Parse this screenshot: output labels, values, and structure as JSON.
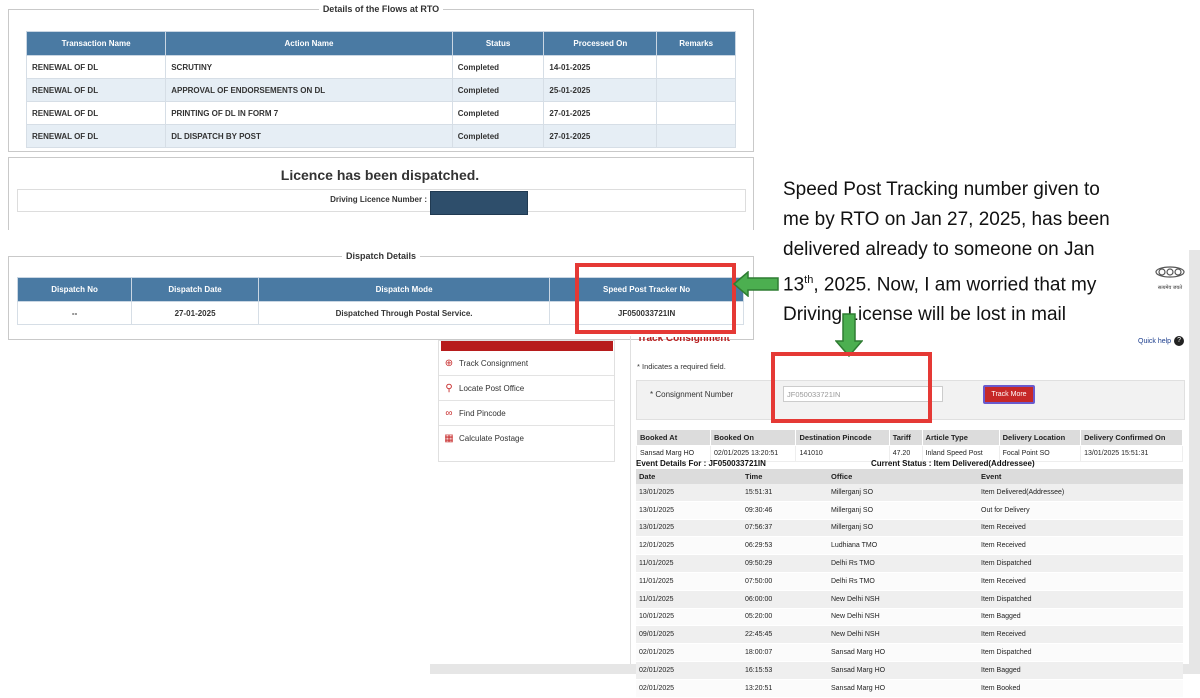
{
  "rto": {
    "legend": "Details of the Flows at RTO",
    "headers": [
      "Transaction Name",
      "Action Name",
      "Status",
      "Processed On",
      "Remarks"
    ],
    "rows": [
      [
        "RENEWAL OF DL",
        "SCRUTINY",
        "Completed",
        "14-01-2025",
        ""
      ],
      [
        "RENEWAL OF DL",
        "APPROVAL OF ENDORSEMENTS ON DL",
        "Completed",
        "25-01-2025",
        ""
      ],
      [
        "RENEWAL OF DL",
        "PRINTING OF DL IN FORM 7",
        "Completed",
        "27-01-2025",
        ""
      ],
      [
        "RENEWAL OF DL",
        "DL DISPATCH BY POST",
        "Completed",
        "27-01-2025",
        ""
      ]
    ]
  },
  "licence": {
    "message": "Licence has been dispatched.",
    "dl_label": "Driving Licence Number :"
  },
  "dispatch": {
    "legend": "Dispatch Details",
    "headers": [
      "Dispatch No",
      "Dispatch Date",
      "Dispatch Mode",
      "Speed Post Tracker No"
    ],
    "row": [
      "--",
      "27-01-2025",
      "Dispatched Through Postal Service.",
      "JF050033721IN"
    ]
  },
  "annotation": {
    "line1": "Speed Post Tracking number given to",
    "line2": "me by RTO on Jan 27, 2025, has been",
    "line3": "delivered already to someone on Jan",
    "line4_a": "13",
    "line4_sup": "th",
    "line4_b": ", 2025. Now, I am worried that my",
    "line5": "Driving License will be lost in mail",
    "arrow_color": "#4caf50",
    "box_color": "#e53935"
  },
  "post": {
    "emblem_text": "सत्यमेव जयते",
    "quick_help": "Quick help",
    "section_title": "Track Consignment",
    "side_menu": [
      "Track Consignment",
      "Locate Post Office",
      "Find Pincode",
      "Calculate Postage"
    ],
    "required_note": "* Indicates a required field.",
    "consignment_label": "* Consignment Number",
    "consignment_value": "JF050033721IN",
    "track_button": "Track More",
    "booking_headers": [
      "Booked At",
      "Booked On",
      "Destination Pincode",
      "Tariff",
      "Article Type",
      "Delivery Location",
      "Delivery Confirmed On"
    ],
    "booking_row": [
      "Sansad Marg HO",
      "02/01/2025 13:20:51",
      "141010",
      "47.20",
      "Inland Speed Post",
      "Focal Point SO",
      "13/01/2025 15:51:31"
    ],
    "event_details_label": "Event Details For : JF050033721IN",
    "current_status": "Current Status : Item Delivered(Addressee)",
    "event_headers": [
      "Date",
      "Time",
      "Office",
      "Event"
    ],
    "events": [
      [
        "13/01/2025",
        "15:51:31",
        "Millerganj SO",
        "Item Delivered(Addressee)"
      ],
      [
        "13/01/2025",
        "09:30:46",
        "Millerganj SO",
        "Out for Delivery"
      ],
      [
        "13/01/2025",
        "07:56:37",
        "Millerganj SO",
        "Item Received"
      ],
      [
        "12/01/2025",
        "06:29:53",
        "Ludhiana TMO",
        "Item Received"
      ],
      [
        "11/01/2025",
        "09:50:29",
        "Delhi Rs TMO",
        "Item Dispatched"
      ],
      [
        "11/01/2025",
        "07:50:00",
        "Delhi Rs TMO",
        "Item Received"
      ],
      [
        "11/01/2025",
        "06:00:00",
        "New Delhi NSH",
        "Item Dispatched"
      ],
      [
        "10/01/2025",
        "05:20:00",
        "New Delhi NSH",
        "Item Bagged"
      ],
      [
        "09/01/2025",
        "22:45:45",
        "New Delhi NSH",
        "Item Received"
      ],
      [
        "02/01/2025",
        "18:00:07",
        "Sansad Marg HO",
        "Item Dispatched"
      ],
      [
        "02/01/2025",
        "16:15:53",
        "Sansad Marg HO",
        "Item Bagged"
      ],
      [
        "02/01/2025",
        "13:20:51",
        "Sansad Marg HO",
        "Item Booked"
      ]
    ]
  }
}
